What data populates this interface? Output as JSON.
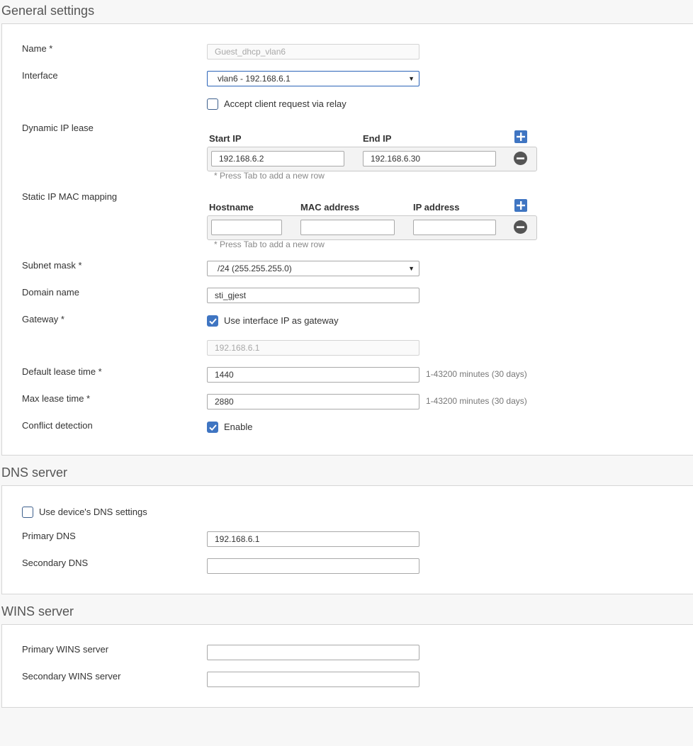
{
  "general": {
    "title": "General settings",
    "name": {
      "label": "Name *",
      "value": "Guest_dhcp_vlan6"
    },
    "interface": {
      "label": "Interface",
      "value": "vlan6 - 192.168.6.1"
    },
    "relay": {
      "label": "Accept client request via relay",
      "checked": false
    },
    "dynamic_lease": {
      "label": "Dynamic IP lease",
      "columns": [
        "Start IP",
        "End IP"
      ],
      "rows": [
        {
          "start": "192.168.6.2",
          "end": "192.168.6.30"
        }
      ],
      "hint": "* Press Tab to add a new row"
    },
    "static_mapping": {
      "label": "Static IP MAC mapping",
      "columns": [
        "Hostname",
        "MAC address",
        "IP address"
      ],
      "rows": [
        {
          "hostname": "",
          "mac": "",
          "ip": ""
        }
      ],
      "hint": "* Press Tab to add a new row"
    },
    "subnet_mask": {
      "label": "Subnet mask *",
      "value": "/24 (255.255.255.0)"
    },
    "domain_name": {
      "label": "Domain name",
      "value": "sti_gjest"
    },
    "gateway": {
      "label": "Gateway *",
      "use_interface_label": "Use interface IP as gateway",
      "checked": true,
      "value": "192.168.6.1"
    },
    "default_lease": {
      "label": "Default lease time *",
      "value": "1440",
      "note": "1-43200 minutes (30 days)"
    },
    "max_lease": {
      "label": "Max lease time *",
      "value": "2880",
      "note": "1-43200 minutes (30 days)"
    },
    "conflict": {
      "label": "Conflict detection",
      "enable_label": "Enable",
      "checked": true
    }
  },
  "dns": {
    "title": "DNS server",
    "use_device": {
      "label": "Use device's DNS settings",
      "checked": false
    },
    "primary": {
      "label": "Primary DNS",
      "value": "192.168.6.1"
    },
    "secondary": {
      "label": "Secondary DNS",
      "value": ""
    }
  },
  "wins": {
    "title": "WINS server",
    "primary": {
      "label": "Primary WINS server",
      "value": ""
    },
    "secondary": {
      "label": "Secondary WINS server",
      "value": ""
    }
  },
  "colors": {
    "accent": "#3f75c2",
    "border": "#a9a9a9"
  }
}
